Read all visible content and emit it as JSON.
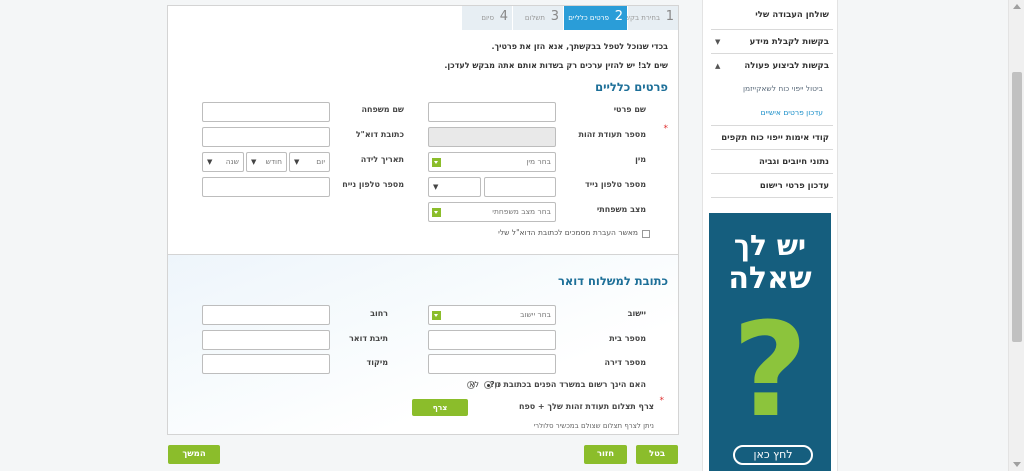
{
  "sidebar": {
    "items": [
      {
        "label": "שולחן העבודה שלי",
        "arrow": ""
      },
      {
        "label": "בקשות לקבלת מידע",
        "arrow": "▼"
      },
      {
        "label": "בקשות לביצוע פעולה",
        "arrow": "▲"
      }
    ],
    "sub_items": [
      {
        "label": "ביטול ייפוי כוח לשאקייזמן"
      },
      {
        "label": "עדכון פרטים אישיים"
      }
    ],
    "bottom_items": [
      {
        "label": "קודי אימות ייפוי כוח תקפים"
      },
      {
        "label": "נתוני חיובים וגביה"
      },
      {
        "label": "עדכון פרטי רישום"
      }
    ]
  },
  "banner": {
    "line1": "יש לך",
    "line2": "שאלה",
    "qmark": "?",
    "button": "לחץ כאן"
  },
  "steps": [
    {
      "num": "1",
      "label": "בחירת בקשה"
    },
    {
      "num": "2",
      "label": "פרטים כלליים"
    },
    {
      "num": "3",
      "label": "תשלום"
    },
    {
      "num": "4",
      "label": "סיום"
    }
  ],
  "intro": {
    "line1": "בכדי שנוכל לטפל בבקשתך, אנא הזן את פרטיך.",
    "line2": "שים לב! יש להזין ערכים רק בשדות אותם אתה מבקש לעדכן."
  },
  "general": {
    "title": "פרטים כלליים",
    "first_name": "שם פרטי",
    "last_name": "שם משפחה",
    "id_number": "מספר תעודת זהות",
    "email": "כתובת דוא\"ל",
    "gender": "מין",
    "gender_placeholder": "בחר מין",
    "birth_date": "תאריך לידה",
    "day": "יום",
    "month": "חודש",
    "year": "שנה",
    "mobile": "מספר טלפון נייד",
    "phone": "מספר טלפון נייח",
    "marital": "מצב משפחתי",
    "marital_placeholder": "בחר מצב משפחתי",
    "consent": "מאשר העברת מסמכים לכתובת הדוא\"ל שלי"
  },
  "mail": {
    "title": "כתובת למשלוח דואר",
    "city": "יישוב",
    "city_placeholder": "בחר יישוב",
    "street": "רחוב",
    "house": "מספר בית",
    "pobox": "תיבת דואר",
    "apartment": "מספר דירה",
    "zip": "מיקוד",
    "registered_q": "האם הינך רשום במשרד הפנים בכתובת זו?",
    "yes": "כן",
    "no": "לא",
    "attach_label": "צרף תצלום תעודת זהות שלך + ספח",
    "attach_button": "צרף",
    "attach_note": "ניתן לצרף תצלום שצולם במכשיר סלולרי"
  },
  "actions": {
    "continue": "המשך",
    "back": "חזור",
    "cancel": "בטל"
  }
}
